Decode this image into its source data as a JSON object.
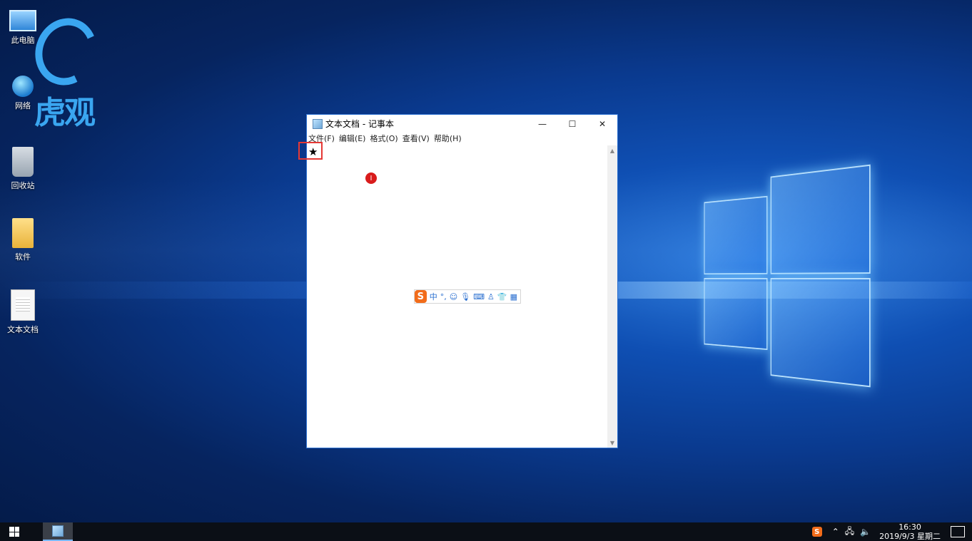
{
  "desktop": {
    "watermark": {
      "text": "虎观"
    },
    "icons": [
      {
        "label": "此电脑",
        "icon": "computer-icon"
      },
      {
        "label": "网络",
        "icon": "network-icon"
      },
      {
        "label": "回收站",
        "icon": "recycle-bin-icon"
      },
      {
        "label": "软件",
        "icon": "folder-icon"
      },
      {
        "label": "文本文档",
        "icon": "text-file-icon"
      }
    ]
  },
  "notepad": {
    "title": "文本文档 - 记事本",
    "controls": {
      "minimize": "—",
      "maximize": "☐",
      "close": "✕"
    },
    "menu": [
      "文件(F)",
      "编辑(E)",
      "格式(O)",
      "查看(V)",
      "帮助(H)"
    ],
    "content": "★",
    "cursor_glyph": "I"
  },
  "ime_toolbar": {
    "logo": "S",
    "mode": "中",
    "punct": "°,",
    "items": [
      "emoji-icon",
      "microphone-icon",
      "keyboard-icon",
      "user-icon",
      "skin-icon",
      "toolbox-icon"
    ]
  },
  "taskbar": {
    "running_app": "notepad",
    "tray": {
      "ime_logo": "S",
      "time": "16:30",
      "date": "2019/9/3 星期二"
    }
  },
  "colors": {
    "accent": "#2a6fd0",
    "highlight_box": "#e53935",
    "sogou_orange": "#f26c1a"
  }
}
